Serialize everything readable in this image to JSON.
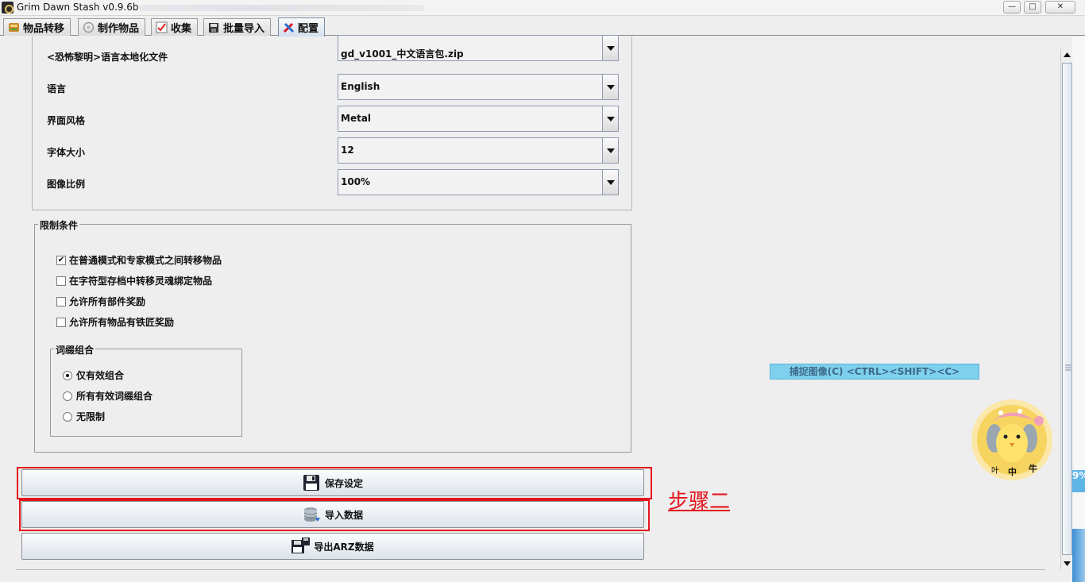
{
  "window": {
    "title": "Grim Dawn Stash v0.9.6b",
    "controls": {
      "minimize": "—",
      "maximize": "□",
      "close": "✕"
    }
  },
  "tabs": [
    {
      "label": "物品转移",
      "icon": "transfer-icon",
      "active": false
    },
    {
      "label": "制作物品",
      "icon": "craft-icon",
      "active": false
    },
    {
      "label": "收集",
      "icon": "collection-icon",
      "active": false
    },
    {
      "label": "批量导入",
      "icon": "import-icon",
      "active": false
    },
    {
      "label": "配置",
      "icon": "config-icon",
      "active": true
    }
  ],
  "settings": [
    {
      "label": "<恐怖黎明>语言本地化文件",
      "value": "gd_v1001_中文语言包.zip"
    },
    {
      "label": "语言",
      "value": "English"
    },
    {
      "label": "界面风格",
      "value": "Metal"
    },
    {
      "label": "字体大小",
      "value": "12"
    },
    {
      "label": "图像比例",
      "value": "100%"
    }
  ],
  "restrictions": {
    "title": "限制条件",
    "checkboxes": [
      {
        "label": "在普通模式和专家模式之间转移物品",
        "checked": true
      },
      {
        "label": "在字符型存档中转移灵魂绑定物品",
        "checked": false
      },
      {
        "label": "允许所有部件奖励",
        "checked": false
      },
      {
        "label": "允许所有物品有铁匠奖励",
        "checked": false
      }
    ],
    "affix_group": {
      "title": "词缀组合",
      "options": [
        {
          "label": "仅有效组合",
          "selected": true
        },
        {
          "label": "所有有效词缀组合",
          "selected": false
        },
        {
          "label": "无限制",
          "selected": false
        }
      ]
    }
  },
  "buttons": {
    "save": "保存设定",
    "import": "导入数据",
    "export": "导出ARZ数据"
  },
  "annotation": {
    "step": "步骤二",
    "color": "#e3141c"
  },
  "capture": {
    "label": "捕捉图像(C)  <CTRL><SHIFT><C>"
  },
  "mascot": {
    "text_left": "叶",
    "text_mid": "中",
    "text_right": "牛"
  },
  "edge": {
    "badge": "9%"
  }
}
